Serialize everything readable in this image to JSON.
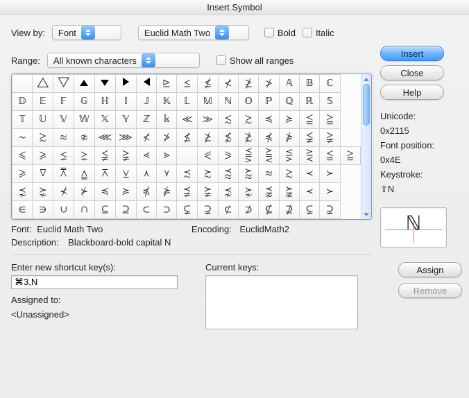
{
  "window": {
    "title": "Insert Symbol"
  },
  "viewby": {
    "label": "View by:",
    "mode": "Font",
    "font": "Euclid Math Two",
    "bold_label": "Bold",
    "italic_label": "Italic"
  },
  "range": {
    "label": "Range:",
    "value": "All known characters",
    "show_all_label": "Show all ranges"
  },
  "buttons": {
    "insert": "Insert",
    "close": "Close",
    "help": "Help",
    "assign": "Assign",
    "remove": "Remove"
  },
  "info": {
    "unicode_label": "Unicode:",
    "unicode": "0x2115",
    "fontpos_label": "Font position:",
    "fontpos": "0x4E",
    "keystroke_label": "Keystroke:",
    "keystroke": "⇧N",
    "preview_glyph": "ℕ"
  },
  "grid": {
    "selected": "N",
    "rows": [
      [
        "",
        "△",
        "▽",
        "▲",
        "▼",
        "▶",
        "◀",
        "⊵",
        "≤",
        "≰",
        "≮",
        "≱",
        "≯",
        "𝔸",
        "𝔹",
        "ℂ"
      ],
      [
        "𝔻",
        "𝔼",
        "𝔽",
        "𝔾",
        "ℍ",
        "𝕀",
        "𝕁",
        "𝕂",
        "𝕃",
        "𝕄",
        "ℕ",
        "𝕆",
        "ℙ",
        "ℚ",
        "ℝ",
        "𝕊"
      ],
      [
        "𝕋",
        "𝕌",
        "𝕍",
        "𝕎",
        "𝕏",
        "𝕐",
        "ℤ",
        "𝕜",
        "≪",
        "≫",
        "≲",
        "≳",
        "≼",
        "≽",
        "≦",
        "≧"
      ],
      [
        "∼",
        "≳",
        "≈",
        "≉",
        "⋘",
        "⋙",
        "≮",
        "≯",
        "≰",
        "≱",
        "≴",
        "≵",
        "⋠",
        "⋡",
        "≨",
        "≩"
      ],
      [
        "⩽",
        "⩾",
        "⪇",
        "⪈",
        "≨",
        "≩",
        "⋖",
        "⋗",
        "",
        "⪕",
        "⪖",
        "⪋",
        "⪌",
        "⋚",
        "⋛",
        "≦",
        "≧"
      ],
      [
        "⩾",
        "⊽",
        "⩞",
        "⩠",
        "⊼",
        "⊻",
        "⋏",
        "⋎",
        "≾",
        "≿",
        "⪷",
        "⪸",
        "≈",
        "≳",
        "≺",
        "≻"
      ],
      [
        "⋨",
        "⋩",
        "⊀",
        "⊁",
        "≼",
        "≽",
        "⋠",
        "⋡",
        "⪵",
        "⪶",
        "⋨",
        "⋩",
        "⪹",
        "⪺",
        "≺",
        "≻"
      ],
      [
        "∈",
        "∋",
        "∪",
        "∩",
        "⊆",
        "⊇",
        "⊂",
        "⊃",
        "⊊",
        "⊋",
        "⊄",
        "⊅",
        "⊈",
        "⊉",
        "⊊",
        "⊋"
      ]
    ]
  },
  "footer": {
    "font_label": "Font:",
    "font_value": "Euclid Math Two",
    "encoding_label": "Encoding:",
    "encoding_value": "EuclidMath2",
    "description_label": "Description:",
    "description_value": "Blackboard-bold capital N"
  },
  "shortcut": {
    "enter_label": "Enter new shortcut key(s):",
    "entered": "⌘3,N",
    "current_label": "Current keys:",
    "assigned_label": "Assigned to:",
    "assigned_value": "<Unassigned>"
  }
}
